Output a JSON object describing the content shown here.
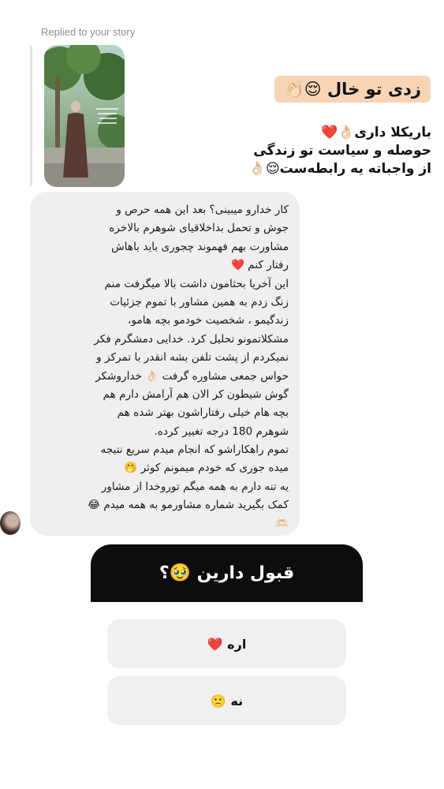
{
  "reply_context": {
    "label": "Replied to your story"
  },
  "story": {
    "sticker": "زدی تو خال 😌👏🏻",
    "caption_lines": [
      "باریکلا داری👌🏻❤️",
      "حوصله و سیاست تو زندگی",
      "از واجباته یه رابطه‌ست😌👌🏻"
    ]
  },
  "message": {
    "lines": [
      "کار خدارو میبینی؟ بعد این همه حرص و",
      "جوش و تحمل بداخلاقیای شوهرم بالاخره",
      "مشاورت بهم فهموند چجوری باید باهاش",
      "رفتار کنم ❤️",
      "این آخریا بحثامون داشت بالا میگرفت منم",
      "زنگ زدم به همین مشاور با تموم جزئیات",
      "زندگیمو ، شخصیت خودمو بچه هامو،",
      "مشکلاتمونو تحلیل کرد. خدایی دمشگرم فکر",
      "نمیکردم از پشت تلفن بشه انقدر با تمرکز و",
      "حواس جمعی مشاوره گرفت 👌🏻 خداروشکر",
      "گوش شیطون کر الان هم آرامش دارم هم",
      "بچه هام خیلی رفتاراشون بهتر شده هم",
      "شوهرم 180 درجه تغییر کرده.",
      "تموم راهکاراشو که انجام میدم سریع نتیجه",
      "میده جوری که خودم میمونم کوثر 🤭",
      "یه تنه دارم به همه میگم توروخدا از مشاور",
      "کمک بگیرید شماره مشاورمو به همه میدم 😂",
      "🫶🏻"
    ]
  },
  "poll": {
    "question": "قبول دارین 🥹؟",
    "options": [
      {
        "label": "اره ❤️"
      },
      {
        "label": "نه 🙁"
      }
    ]
  },
  "colors": {
    "bubble_bg": "#efeff1",
    "sticker_bg": "#f7d5b4",
    "poll_header_bg": "#0d0d0d",
    "poll_option_bg": "#f0f0f2"
  }
}
